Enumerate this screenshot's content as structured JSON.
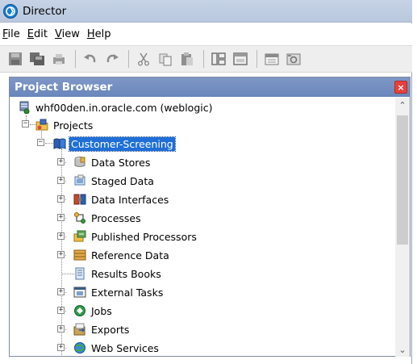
{
  "window": {
    "title": "Director"
  },
  "menu": [
    {
      "key": "F",
      "rest": "ile"
    },
    {
      "key": "E",
      "rest": "dit"
    },
    {
      "key": "V",
      "rest": "iew"
    },
    {
      "key": "H",
      "rest": "elp"
    }
  ],
  "toolbar": {
    "buttons": [
      "save-icon",
      "save-all-icon",
      "print-icon",
      "undo-icon",
      "redo-icon",
      "cut-icon",
      "copy-icon",
      "paste-icon",
      "layout-icon",
      "window-icon",
      "calendar-icon",
      "snapshot-icon"
    ]
  },
  "panel": {
    "title": "Project Browser",
    "close_glyph": "×"
  },
  "tree": {
    "server": "whf00den.in.oracle.com (weblogic)",
    "projects": "Projects",
    "project": "Customer-Screening",
    "children": [
      {
        "label": "Data Stores",
        "icon": "database-icon",
        "expandable": true
      },
      {
        "label": "Staged Data",
        "icon": "staged-data-icon",
        "expandable": true
      },
      {
        "label": "Data Interfaces",
        "icon": "data-interface-icon",
        "expandable": true
      },
      {
        "label": "Processes",
        "icon": "process-icon",
        "expandable": true
      },
      {
        "label": "Published Processors",
        "icon": "published-processor-icon",
        "expandable": true
      },
      {
        "label": "Reference Data",
        "icon": "reference-data-icon",
        "expandable": true
      },
      {
        "label": "Results Books",
        "icon": "results-book-icon",
        "expandable": false
      },
      {
        "label": "External Tasks",
        "icon": "external-task-icon",
        "expandable": true
      },
      {
        "label": "Jobs",
        "icon": "jobs-icon",
        "expandable": true
      },
      {
        "label": "Exports",
        "icon": "exports-icon",
        "expandable": true
      },
      {
        "label": "Web Services",
        "icon": "web-services-icon",
        "expandable": true
      }
    ]
  },
  "glyphs": {
    "plus": "+",
    "minus": "−",
    "scroll_up": "⌃",
    "scroll_down": "⌄"
  }
}
